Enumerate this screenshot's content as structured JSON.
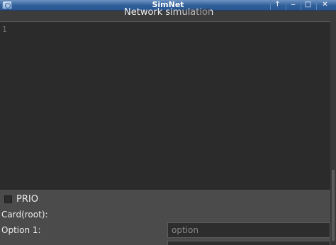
{
  "window": {
    "title": "SimNet",
    "controls": {
      "up": "↑",
      "minimize": "‒",
      "maximize": "□",
      "close": "✕"
    }
  },
  "header": {
    "subtitle": "Network simulation"
  },
  "editor": {
    "line_numbers": [
      "1"
    ],
    "content": ""
  },
  "form": {
    "prio_label": "PRIO",
    "prio_checked": false,
    "card_label": "Card(root):",
    "option1_label": "Option 1:",
    "option1_placeholder": "option",
    "option1_value": ""
  },
  "colors": {
    "titlebar": "#2f5f9a",
    "editor_bg": "#2b2b2b",
    "panel_bg": "#4b4b4b",
    "text": "#ececec"
  }
}
